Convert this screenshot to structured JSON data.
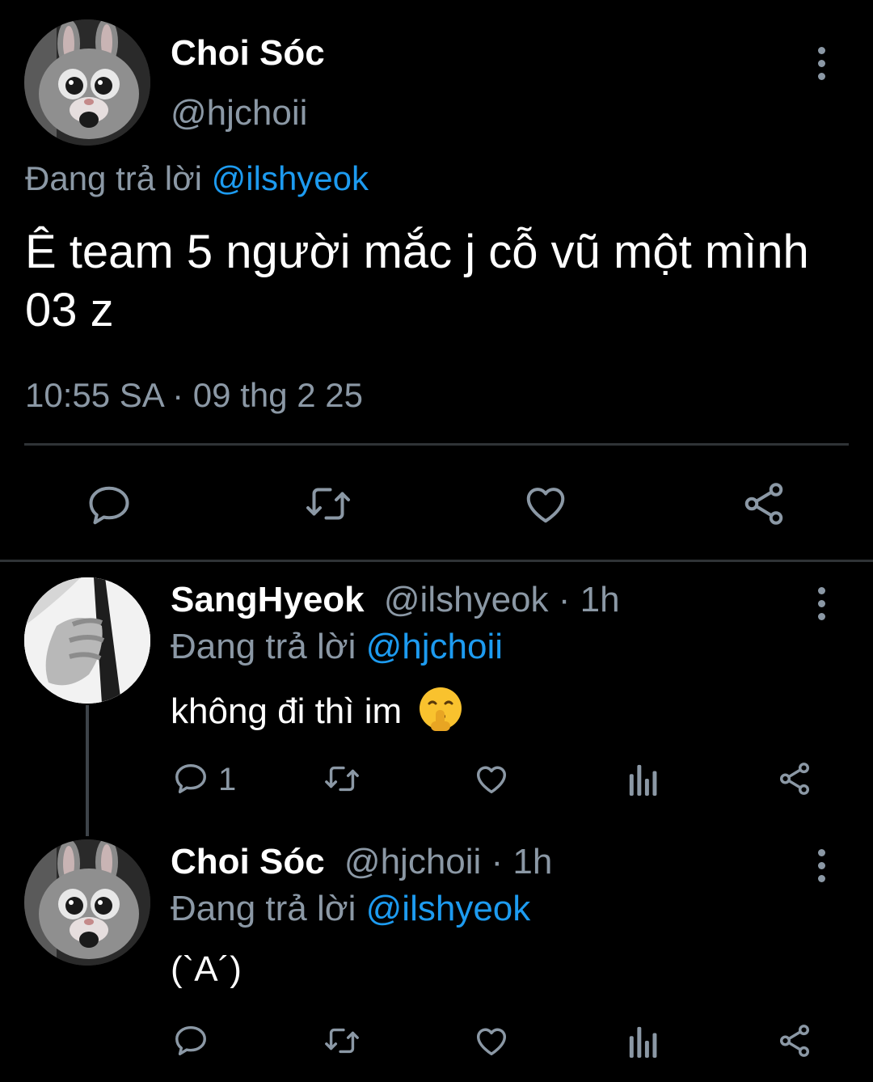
{
  "main_tweet": {
    "author_name": "Choi Sóc",
    "author_handle": "@hjchoii",
    "reply_prefix": "Đang trả lời",
    "reply_to": "@ilshyeok",
    "text_line1": "Ê team 5 người mắc j cỗ vũ một mình",
    "text_line2": "03 z",
    "timestamp": "10:55 SA · 09 thg 2 25",
    "actions": [
      "reply-icon",
      "retweet-icon",
      "like-icon",
      "share-icon"
    ]
  },
  "replies": [
    {
      "author_name": "SangHyeok",
      "meta": "@ilshyeok · 1h",
      "reply_prefix": "Đang trả lời",
      "reply_to": "@hjchoii",
      "text": "không đi thì im",
      "emoji": "shushing-face-emoji",
      "reply_count": "1"
    },
    {
      "author_name": "Choi Sóc",
      "meta": "@hjchoii · 1h",
      "reply_prefix": "Đang trả lời",
      "reply_to": "@ilshyeok",
      "text": "(`A´)",
      "reply_count": ""
    }
  ],
  "colors": {
    "background": "#000000",
    "text": "#e7e9ea",
    "secondary": "#8b98a5",
    "link": "#1d9bf0",
    "divider": "#2f3336"
  }
}
